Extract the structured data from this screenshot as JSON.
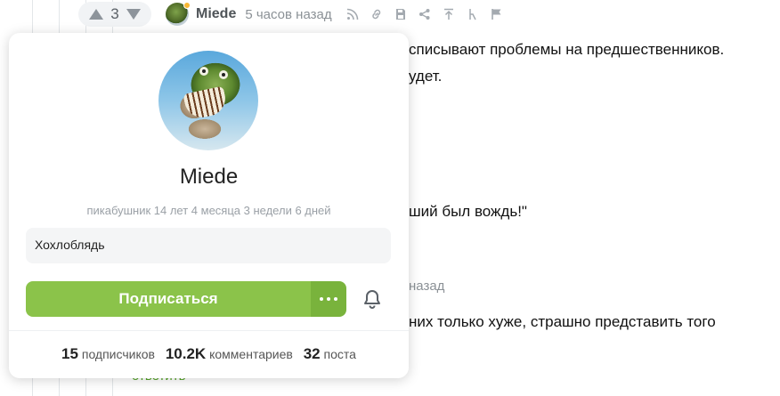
{
  "comment": {
    "votes": "3",
    "author": "Miede",
    "time": "5 часов назад"
  },
  "background": {
    "line1": "списывают проблемы на предшественников.",
    "line2": "удет.",
    "line3": "ший был вождь!\"",
    "meta2": "назад",
    "line4": "них только хуже, страшно представить того",
    "reply": "ответить"
  },
  "profile": {
    "name": "Miede",
    "meta": "пикабушник 14 лет 4 месяца 3 недели 6 дней",
    "note": "Хохлоблядь",
    "subscribe_label": "Подписаться",
    "stats": {
      "subscribers_value": "15",
      "subscribers_label": "подписчиков",
      "comments_value": "10.2K",
      "comments_label": "комментариев",
      "posts_value": "32",
      "posts_label": "поста"
    }
  },
  "colors": {
    "accent": "#8bc34a",
    "online": "#f7b733"
  },
  "icons": [
    "rss-icon",
    "link-icon",
    "save-icon",
    "share-icon",
    "upload-icon",
    "branch-icon",
    "flag-icon",
    "bell-icon",
    "more-dots-icon"
  ]
}
